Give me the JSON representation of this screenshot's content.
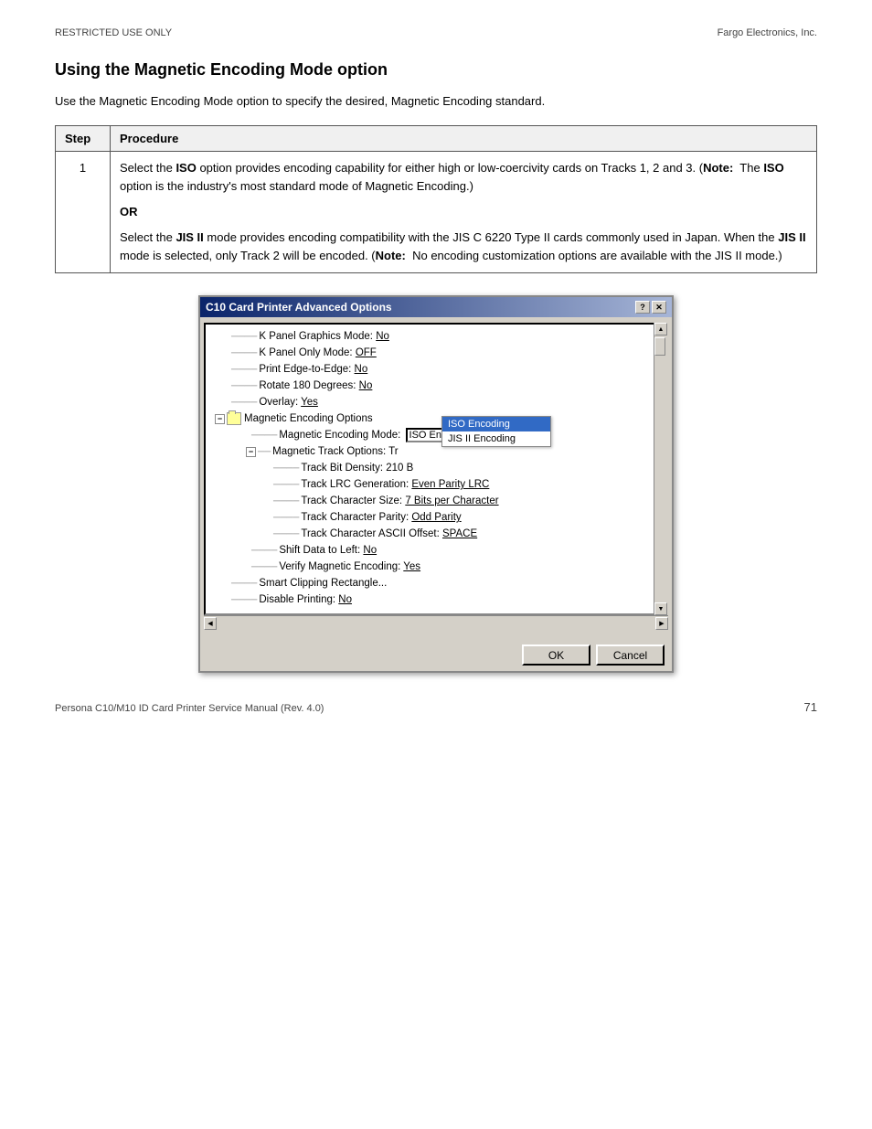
{
  "header": {
    "left": "RESTRICTED USE ONLY",
    "right": "Fargo Electronics, Inc."
  },
  "section": {
    "title": "Using the Magnetic Encoding Mode option",
    "intro": "Use the Magnetic Encoding Mode option to specify the desired, Magnetic Encoding standard."
  },
  "table": {
    "col1_header": "Step",
    "col2_header": "Procedure",
    "rows": [
      {
        "step": "1",
        "content_parts": [
          {
            "type": "text",
            "text": "Select the "
          },
          {
            "type": "bold",
            "text": "ISO"
          },
          {
            "type": "text",
            "text": " option provides encoding capability for either high or low-coercivity cards on Tracks 1, 2 and 3. ("
          },
          {
            "type": "bold",
            "text": "Note:"
          },
          {
            "type": "text",
            "text": "  The "
          },
          {
            "type": "bold",
            "text": "ISO"
          },
          {
            "type": "text",
            "text": " option is the industry's most standard mode of Magnetic Encoding.)"
          },
          {
            "type": "or"
          },
          {
            "type": "text",
            "text": "Select the "
          },
          {
            "type": "bold",
            "text": "JIS II"
          },
          {
            "type": "text",
            "text": " mode provides encoding compatibility with the JIS C 6220 Type II cards commonly used in Japan. When the "
          },
          {
            "type": "bold",
            "text": "JIS II"
          },
          {
            "type": "text",
            "text": " mode is selected, only Track 2 will be encoded. ("
          },
          {
            "type": "bold",
            "text": "Note:"
          },
          {
            "type": "text",
            "text": "  No encoding customization options are available with the JIS II mode.)"
          }
        ]
      }
    ]
  },
  "dialog": {
    "title": "C10 Card Printer Advanced Options",
    "title_btn_help": "?",
    "title_btn_close": "✕",
    "tree_items": [
      {
        "indent": 1,
        "dash": true,
        "text": "K Panel Graphics Mode: ",
        "value": "No",
        "level": 1
      },
      {
        "indent": 1,
        "dash": true,
        "text": "K Panel Only Mode: ",
        "value": "OFF",
        "level": 1
      },
      {
        "indent": 1,
        "dash": true,
        "text": "Print Edge-to-Edge: ",
        "value": "No",
        "level": 1
      },
      {
        "indent": 1,
        "dash": true,
        "text": "Rotate 180 Degrees: ",
        "value": "No",
        "level": 1
      },
      {
        "indent": 1,
        "dash": true,
        "text": "Overlay: ",
        "value": "Yes",
        "level": 1
      },
      {
        "indent": 0,
        "expand": "minus",
        "folder": true,
        "text": "Magnetic Encoding Options",
        "level": 0
      },
      {
        "indent": 2,
        "dash": true,
        "text": "Magnetic Encoding Mode: ",
        "dropdown": true,
        "dropdown_value": "ISO Encoding",
        "level": 2
      },
      {
        "indent": 2,
        "expand": "minus",
        "dash": true,
        "text": "Magnetic Track Options: Tr",
        "level": 2
      },
      {
        "indent": 3,
        "dash": true,
        "text": "Track Bit Density: 210 B",
        "level": 3
      },
      {
        "indent": 3,
        "dash": true,
        "text": "Track LRC Generation: ",
        "value_underline": "Even Parity LRC",
        "level": 3
      },
      {
        "indent": 3,
        "dash": true,
        "text": "Track Character Size: ",
        "value_underline": "7 Bits per Character",
        "level": 3
      },
      {
        "indent": 3,
        "dash": true,
        "text": "Track Character Parity: ",
        "value_underline": "Odd Parity",
        "level": 3
      },
      {
        "indent": 3,
        "dash": true,
        "text": "Track Character ASCII Offset: ",
        "value_underline": "SPACE",
        "level": 3
      },
      {
        "indent": 2,
        "dash": true,
        "text": "Shift Data to Left: ",
        "value": "No",
        "level": 2
      },
      {
        "indent": 2,
        "dash": true,
        "text": "Verify Magnetic Encoding: ",
        "value": "Yes",
        "level": 2
      },
      {
        "indent": 1,
        "dash": true,
        "text": "Smart Clipping Rectangle...",
        "level": 1
      },
      {
        "indent": 1,
        "dash": true,
        "text": "Disable Printing: ",
        "value": "No",
        "level": 1
      }
    ],
    "dropdown_popup": {
      "items": [
        {
          "label": "ISO Encoding",
          "selected": true
        },
        {
          "label": "JIS II Encoding",
          "selected": false
        }
      ]
    },
    "ok_label": "OK",
    "cancel_label": "Cancel"
  },
  "footer": {
    "left": "Persona C10/M10 ID Card Printer Service Manual (Rev. 4.0)",
    "page": "71"
  }
}
